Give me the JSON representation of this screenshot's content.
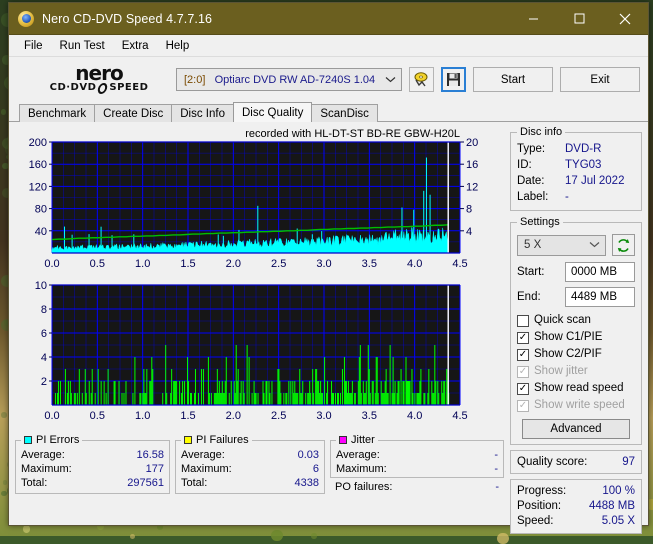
{
  "window": {
    "title": "Nero CD-DVD Speed 4.7.7.16",
    "app_icon": "nero-disc-icon",
    "minimize": "minimize-icon",
    "maximize": "maximize-icon",
    "close": "close-icon"
  },
  "menu": [
    {
      "label": "File"
    },
    {
      "label": "Run Test"
    },
    {
      "label": "Extra"
    },
    {
      "label": "Help"
    }
  ],
  "toolbar": {
    "logo_line1": "nero",
    "logo_line2_left": "CD·DVD",
    "logo_line2_right": "SPEED",
    "drive_index": "[2:0]",
    "drive_name": "Optiarc DVD RW AD-7240S 1.04",
    "eject_icon": "eject-disc-icon",
    "save_icon": "floppy-save-icon",
    "start_label": "Start",
    "exit_label": "Exit"
  },
  "tabs": [
    {
      "label": "Benchmark",
      "active": false
    },
    {
      "label": "Create Disc",
      "active": false
    },
    {
      "label": "Disc Info",
      "active": false
    },
    {
      "label": "Disc Quality",
      "active": true
    },
    {
      "label": "ScanDisc",
      "active": false
    }
  ],
  "chart_data": [
    {
      "type": "area",
      "name": "pi-errors-chart",
      "title": "recorded with HL-DT-ST BD-RE  GBW-H20L",
      "xlabel": "",
      "ylabel": "PI Errors",
      "xlim": [
        0.0,
        4.5
      ],
      "ylim": [
        0,
        200
      ],
      "xticks": [
        0.0,
        0.5,
        1.0,
        1.5,
        2.0,
        2.5,
        3.0,
        3.5,
        4.0,
        4.5
      ],
      "xticklabels": [
        "0.0",
        "0.5",
        "1.0",
        "1.5",
        "2.0",
        "2.5",
        "3.0",
        "3.5",
        "4.0",
        "4.5"
      ],
      "yticks": [
        40,
        80,
        120,
        160,
        200
      ],
      "yticklabels": [
        "40",
        "80",
        "120",
        "160",
        "200"
      ],
      "y2lim": [
        0,
        20
      ],
      "y2ticks": [
        4,
        8,
        12,
        16,
        20
      ],
      "y2ticklabels": [
        "4",
        "8",
        "12",
        "16",
        "20"
      ],
      "grid": true,
      "bg_color": "#161616",
      "grid_color": "#0000ff",
      "series": [
        {
          "name": "PI Errors",
          "color": "#00ffff",
          "type": "area"
        },
        {
          "name": "Read speed",
          "color": "#00c000",
          "type": "line",
          "axis": "right"
        }
      ],
      "data_end_x": 4.37,
      "spikes": [
        {
          "x": 2.27,
          "y": 85
        },
        {
          "x": 3.86,
          "y": 82
        },
        {
          "x": 3.99,
          "y": 78
        },
        {
          "x": 4.1,
          "y": 112
        },
        {
          "x": 4.13,
          "y": 172
        },
        {
          "x": 4.17,
          "y": 105
        }
      ]
    },
    {
      "type": "bar",
      "name": "pi-failures-chart",
      "xlabel": "",
      "ylabel": "PI Failures",
      "xlim": [
        0.0,
        4.5
      ],
      "ylim": [
        0,
        10
      ],
      "xticks": [
        0.0,
        0.5,
        1.0,
        1.5,
        2.0,
        2.5,
        3.0,
        3.5,
        4.0,
        4.5
      ],
      "xticklabels": [
        "0.0",
        "0.5",
        "1.0",
        "1.5",
        "2.0",
        "2.5",
        "3.0",
        "3.5",
        "4.0",
        "4.5"
      ],
      "yticks": [
        2,
        4,
        6,
        8,
        10
      ],
      "yticklabels": [
        "2",
        "4",
        "6",
        "8",
        "10"
      ],
      "grid": true,
      "bg_color": "#161616",
      "grid_color": "#0000ff",
      "series": [
        {
          "name": "PI Failures",
          "color": "#00ff00",
          "type": "bar"
        }
      ],
      "data_end_x": 4.37
    }
  ],
  "stats": {
    "pi_errors": {
      "legend": "PI Errors",
      "color": "#00ffff",
      "rows": [
        {
          "key": "Average:",
          "value": "16.58"
        },
        {
          "key": "Maximum:",
          "value": "177"
        },
        {
          "key": "Total:",
          "value": "297561"
        }
      ]
    },
    "pi_failures": {
      "legend": "PI Failures",
      "color": "#ffff00",
      "rows": [
        {
          "key": "Average:",
          "value": "0.03"
        },
        {
          "key": "Maximum:",
          "value": "6"
        },
        {
          "key": "Total:",
          "value": "4338"
        }
      ]
    },
    "jitter": {
      "legend": "Jitter",
      "color": "#ff00ff",
      "rows": [
        {
          "key": "Average:",
          "value": "-"
        },
        {
          "key": "Maximum:",
          "value": "-"
        }
      ],
      "po_failures": {
        "key": "PO failures:",
        "value": "-"
      }
    }
  },
  "disc_info": {
    "legend": "Disc info",
    "rows": [
      {
        "key": "Type:",
        "value": "DVD-R"
      },
      {
        "key": "ID:",
        "value": "TYG03"
      },
      {
        "key": "Date:",
        "value": "17 Jul 2022"
      },
      {
        "key": "Label:",
        "value": "-"
      }
    ]
  },
  "settings": {
    "legend": "Settings",
    "speed_value": "5 X",
    "refresh_icon": "refresh-icon",
    "start_label": "Start:",
    "start_value": "0000 MB",
    "end_label": "End:",
    "end_value": "4489 MB",
    "checkboxes": [
      {
        "label": "Quick scan",
        "checked": false,
        "disabled": false
      },
      {
        "label": "Show C1/PIE",
        "checked": true,
        "disabled": false
      },
      {
        "label": "Show C2/PIF",
        "checked": true,
        "disabled": false
      },
      {
        "label": "Show jitter",
        "checked": true,
        "disabled": true
      },
      {
        "label": "Show read speed",
        "checked": true,
        "disabled": false
      },
      {
        "label": "Show write speed",
        "checked": true,
        "disabled": true
      }
    ],
    "advanced_label": "Advanced"
  },
  "quality": {
    "label": "Quality score:",
    "value": "97"
  },
  "progress": {
    "rows": [
      {
        "key": "Progress:",
        "value": "100 %"
      },
      {
        "key": "Position:",
        "value": "4488 MB"
      },
      {
        "key": "Speed:",
        "value": "5.05 X"
      }
    ]
  }
}
